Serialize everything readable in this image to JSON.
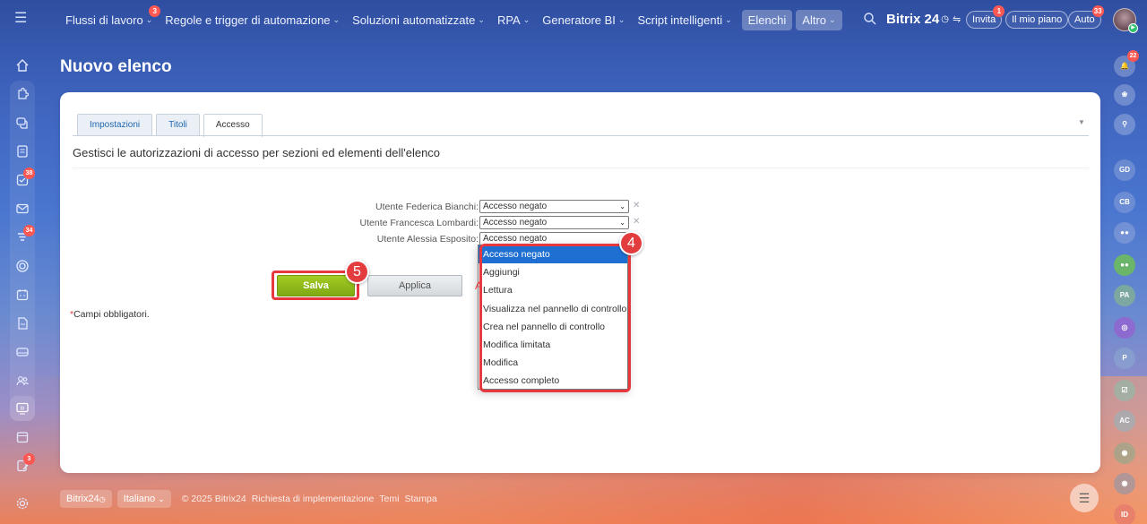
{
  "topbar": {
    "nav": [
      {
        "label": "Flussi di lavoro",
        "badge": "3",
        "chevron": true,
        "active": false
      },
      {
        "label": "Regole e trigger di automazione",
        "badge": "",
        "chevron": true,
        "active": false
      },
      {
        "label": "Soluzioni automatizzate",
        "badge": "",
        "chevron": true,
        "active": false
      },
      {
        "label": "RPA",
        "badge": "",
        "chevron": true,
        "active": false
      },
      {
        "label": "Generatore BI",
        "badge": "",
        "chevron": true,
        "active": false
      },
      {
        "label": "Script intelligenti",
        "badge": "",
        "chevron": true,
        "active": false
      },
      {
        "label": "Elenchi",
        "badge": "",
        "chevron": false,
        "active": true
      },
      {
        "label": "Altro",
        "badge": "",
        "chevron": true,
        "active": true
      }
    ],
    "brand": "Bitrix 24",
    "invite": {
      "label": "Invita",
      "badge": "1"
    },
    "plan": {
      "label": "Il mio piano"
    },
    "auto": {
      "label": "Auto",
      "badge": "33"
    }
  },
  "leftbar": {
    "badges": {
      "tasks": "38",
      "feed": "34",
      "approvals": "3"
    }
  },
  "rightbar": {
    "notifications_badge": "22",
    "avatars": [
      "GD",
      "CB",
      "PA",
      "P",
      "AC",
      "ID"
    ]
  },
  "page": {
    "title": "Nuovo elenco"
  },
  "tabs": [
    "Impostazioni",
    "Titoli",
    "Accesso"
  ],
  "description": "Gestisci le autorizzazioni di accesso per sezioni ed elementi dell'elenco",
  "permissions": [
    {
      "label": "Utente Federica Bianchi:",
      "value": "Accesso negato"
    },
    {
      "label": "Utente Francesca Lombardi:",
      "value": "Accesso negato"
    },
    {
      "label": "Utente Alessia Esposito:",
      "value": "Accesso negato"
    }
  ],
  "dropdown_options": [
    "Accesso negato",
    "Aggiungi",
    "Lettura",
    "Visualizza nel pannello di controllo",
    "Crea nel pannello di controllo",
    "Modifica limitata",
    "Modifica",
    "Accesso completo"
  ],
  "buttons": {
    "save": "Salva",
    "apply": "Applica",
    "cancel_fragment": "A"
  },
  "required_note": {
    "star": "*",
    "text": "Campi obbligatori."
  },
  "steps": {
    "dropdown": "4",
    "save": "5"
  },
  "footer": {
    "brand": "Bitrix24",
    "language": "Italiano",
    "copyright": "© 2025 Bitrix24",
    "links": [
      "Richiesta di implementazione",
      "Temi",
      "Stampa"
    ]
  }
}
